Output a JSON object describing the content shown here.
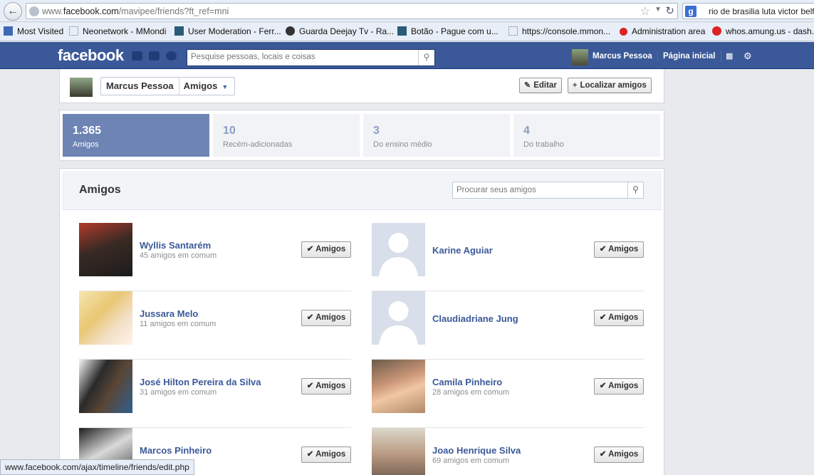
{
  "browser": {
    "url_prefix": "www.",
    "url_domain": "facebook.com",
    "url_path": "/mavipee/friends?ft_ref=mni",
    "search_text": "rio de brasilia luta victor belf",
    "bookmarks": [
      "Most Visited",
      "Neonetwork - MMondi",
      "User Moderation - Ferr...",
      "Guarda Deejay Tv - Ra...",
      "Botão - Pague com u...",
      "https://console.mmon...",
      "Administration area",
      "whos.amung.us - dash..."
    ],
    "status_url": "www.facebook.com/ajax/timeline/friends/edit.php"
  },
  "fb_header": {
    "logo": "facebook",
    "search_placeholder": "Pesquise pessoas, locais e coisas",
    "user_name": "Marcus Pessoa",
    "home_label": "Página inicial"
  },
  "profile_bar": {
    "name": "Marcus Pessoa",
    "section": "Amigos",
    "edit_label": "Editar",
    "find_label": "Localizar amigos"
  },
  "stats": [
    {
      "count": "1.365",
      "label": "Amigos",
      "active": true
    },
    {
      "count": "10",
      "label": "Recém-adicionadas",
      "active": false
    },
    {
      "count": "3",
      "label": "Do ensino médio",
      "active": false
    },
    {
      "count": "4",
      "label": "Do trabalho",
      "active": false
    }
  ],
  "friends_section": {
    "title": "Amigos",
    "search_placeholder": "Procurar seus amigos",
    "button_label": "Amigos",
    "friends": [
      {
        "name": "Wyllis Santarém",
        "mutual": "45 amigos em comum"
      },
      {
        "name": "Karine Aguiar",
        "mutual": ""
      },
      {
        "name": "Jussara Melo",
        "mutual": "11 amigos em comum"
      },
      {
        "name": "Claudiadriane Jung",
        "mutual": ""
      },
      {
        "name": "José Hilton Pereira da Silva",
        "mutual": "31 amigos em comum"
      },
      {
        "name": "Camila Pinheiro",
        "mutual": "28 amigos em comum"
      },
      {
        "name": "Marcos Pinheiro",
        "mutual": ""
      },
      {
        "name": "Joao Henrique Silva",
        "mutual": "69 amigos em comum"
      }
    ]
  },
  "colors": {
    "brand_blue": "#3b5998",
    "active_stat": "#6d84b4",
    "link": "#3b5998"
  }
}
